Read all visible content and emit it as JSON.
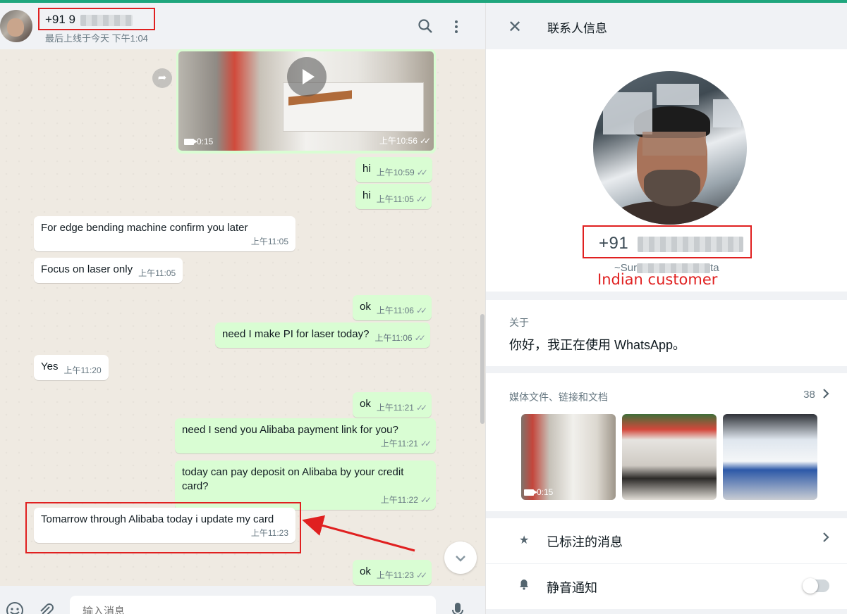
{
  "chat": {
    "header": {
      "name": "+91 9",
      "status": "最后上线于今天 下午1:04"
    },
    "video": {
      "duration": "0:15",
      "time": "上午10:56"
    },
    "messages": [
      {
        "dir": "out",
        "text": "hi",
        "time": "上午10:59"
      },
      {
        "dir": "out",
        "text": "hi",
        "time": "上午11:05"
      },
      {
        "dir": "in",
        "text": "For edge bending machine confirm you later",
        "time": "上午11:05"
      },
      {
        "dir": "in",
        "text": "Focus on laser only",
        "time": "上午11:05"
      },
      {
        "dir": "out",
        "text": "ok",
        "time": "上午11:06"
      },
      {
        "dir": "out",
        "text": "need I make PI for laser today?",
        "time": "上午11:06"
      },
      {
        "dir": "in",
        "text": "Yes",
        "time": "上午11:20"
      },
      {
        "dir": "out",
        "text": "ok",
        "time": "上午11:21"
      },
      {
        "dir": "out",
        "text": "need I send you Alibaba payment link for you?",
        "time": "上午11:21"
      },
      {
        "dir": "out",
        "text": "today can pay deposit on Alibaba by your credit card?",
        "time": "上午11:22"
      },
      {
        "dir": "in",
        "text": "Tomarrow through Alibaba today i update my card",
        "time": "上午11:23"
      },
      {
        "dir": "out",
        "text": "ok",
        "time": "上午11:23"
      }
    ],
    "input_placeholder": "输入消息"
  },
  "info": {
    "title": "联系人信息",
    "phone": "+91",
    "alias_prefix": "~Sur",
    "alias_suffix": "ta",
    "annotation": "Indian customer",
    "about_label": "关于",
    "about_text": "你好，我正在使用 WhatsApp。",
    "media_label": "媒体文件、链接和文档",
    "media_count": "38",
    "media_thumb_duration": "0:15",
    "starred_label": "已标注的消息",
    "mute_label": "静音通知"
  },
  "colors": {
    "accent": "#1fa67d",
    "outgoing_bubble": "#d9fdd3",
    "incoming_bubble": "#ffffff",
    "chat_bg": "#efeae2",
    "annotation_red": "#e02020"
  }
}
